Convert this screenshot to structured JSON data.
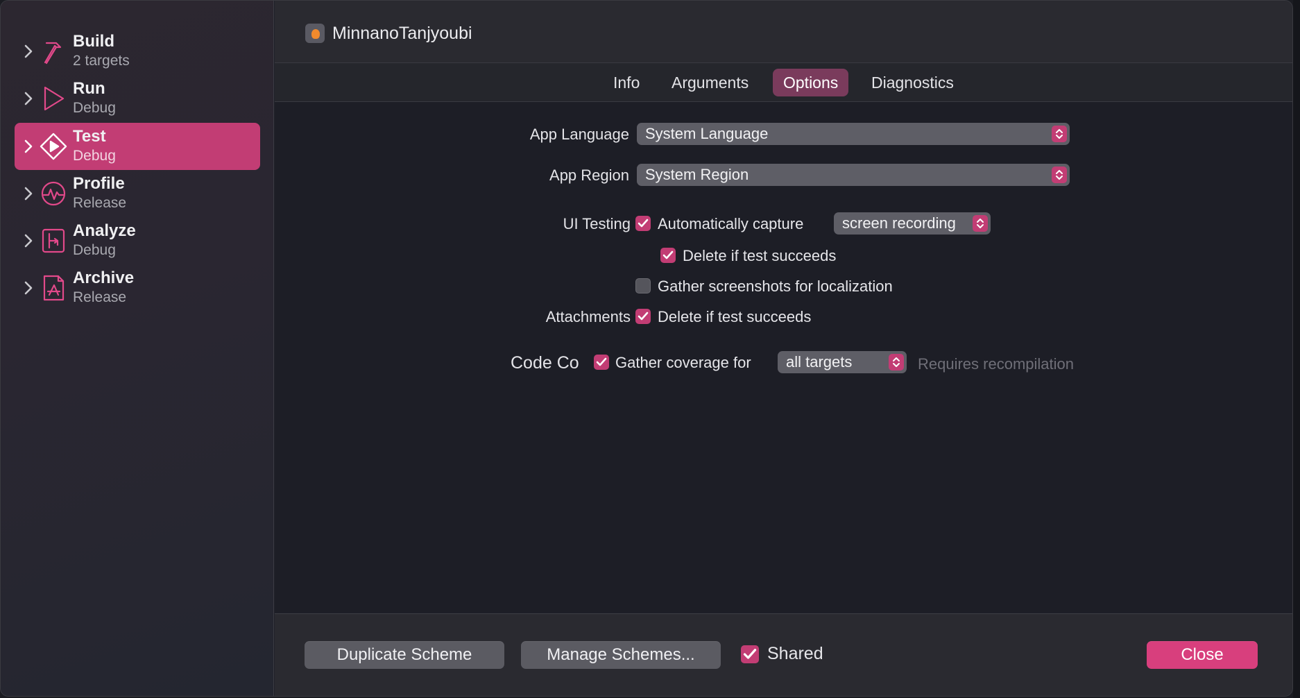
{
  "sidebar": {
    "items": [
      {
        "title": "Build",
        "subtitle": "2 targets",
        "icon": "hammer-icon"
      },
      {
        "title": "Run",
        "subtitle": "Debug",
        "icon": "play-icon"
      },
      {
        "title": "Test",
        "subtitle": "Debug",
        "icon": "diamond-play-icon",
        "selected": true
      },
      {
        "title": "Profile",
        "subtitle": "Release",
        "icon": "gauge-icon"
      },
      {
        "title": "Analyze",
        "subtitle": "Debug",
        "icon": "branch-icon"
      },
      {
        "title": "Archive",
        "subtitle": "Release",
        "icon": "appstore-icon"
      }
    ]
  },
  "header": {
    "app_name": "MinnanoTanjyoubi"
  },
  "tabs": [
    {
      "label": "Info"
    },
    {
      "label": "Arguments"
    },
    {
      "label": "Options",
      "active": true
    },
    {
      "label": "Diagnostics"
    }
  ],
  "options": {
    "app_language_label": "App Language",
    "app_language_value": "System Language",
    "app_region_label": "App Region",
    "app_region_value": "System Region",
    "ui_testing_label": "UI Testing",
    "auto_capture_label": "Automatically capture",
    "auto_capture_checked": true,
    "capture_mode_value": "screen recording",
    "delete_if_succeeds_label": "Delete if test succeeds",
    "delete_if_succeeds_checked": true,
    "gather_screenshots_label": "Gather screenshots for localization",
    "gather_screenshots_checked": false,
    "attachments_label": "Attachments",
    "attachments_delete_label": "Delete if test succeeds",
    "attachments_delete_checked": true,
    "code_coverage_label": "Code Co",
    "gather_coverage_label": "Gather coverage for",
    "gather_coverage_checked": true,
    "coverage_targets_value": "all targets",
    "requires_recompilation": "Requires recompilation"
  },
  "footer": {
    "duplicate_label": "Duplicate Scheme",
    "manage_label": "Manage Schemes...",
    "shared_label": "Shared",
    "shared_checked": true,
    "close_label": "Close"
  },
  "colors": {
    "accent": "#c23d74",
    "close_button": "#d83f7d",
    "active_tab": "#7a3b5c"
  }
}
